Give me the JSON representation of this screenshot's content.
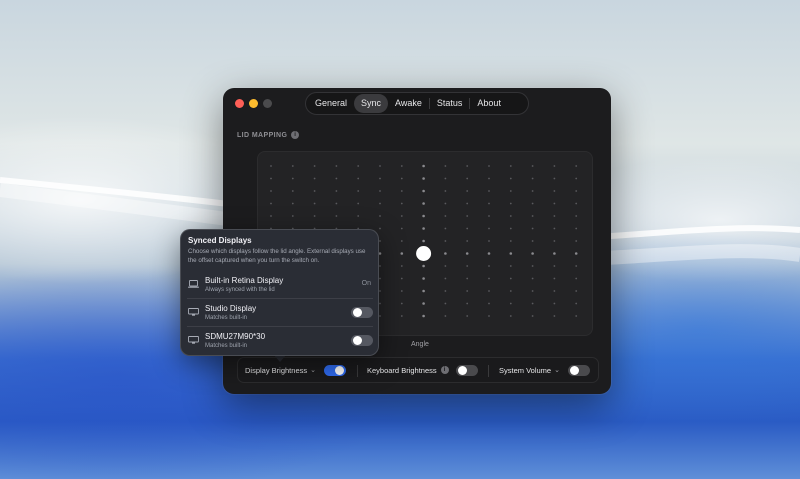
{
  "window": {
    "tabs": [
      {
        "label": "General",
        "active": false
      },
      {
        "label": "Sync",
        "active": true
      },
      {
        "label": "Awake",
        "active": false
      },
      {
        "label": "Status",
        "active": false
      },
      {
        "label": "About",
        "active": false
      }
    ],
    "section_label": "LID MAPPING",
    "axis_label": "Angle",
    "bottom_bar": {
      "display_brightness": {
        "label": "Display Brightness",
        "on": true
      },
      "keyboard_brightness": {
        "label": "Keyboard Brightness",
        "on": false
      },
      "system_volume": {
        "label": "System Volume",
        "on": false
      }
    }
  },
  "popover": {
    "title": "Synced Displays",
    "description": "Choose which displays follow the lid angle. External displays use the offset captured when you turn the switch on.",
    "displays": [
      {
        "name": "Built-in Retina Display",
        "subtitle": "Always synced with the lid",
        "status": "On",
        "icon": "laptop-icon"
      },
      {
        "name": "Studio Display",
        "subtitle": "Matches built-in",
        "on": false,
        "icon": "monitor-icon"
      },
      {
        "name": "SDMU27M90*30",
        "subtitle": "Matches built-in",
        "on": false,
        "icon": "monitor-icon"
      }
    ]
  },
  "colors": {
    "accent": "#2f6bf0",
    "close": "#fe5f57",
    "minimize": "#febc2e"
  }
}
